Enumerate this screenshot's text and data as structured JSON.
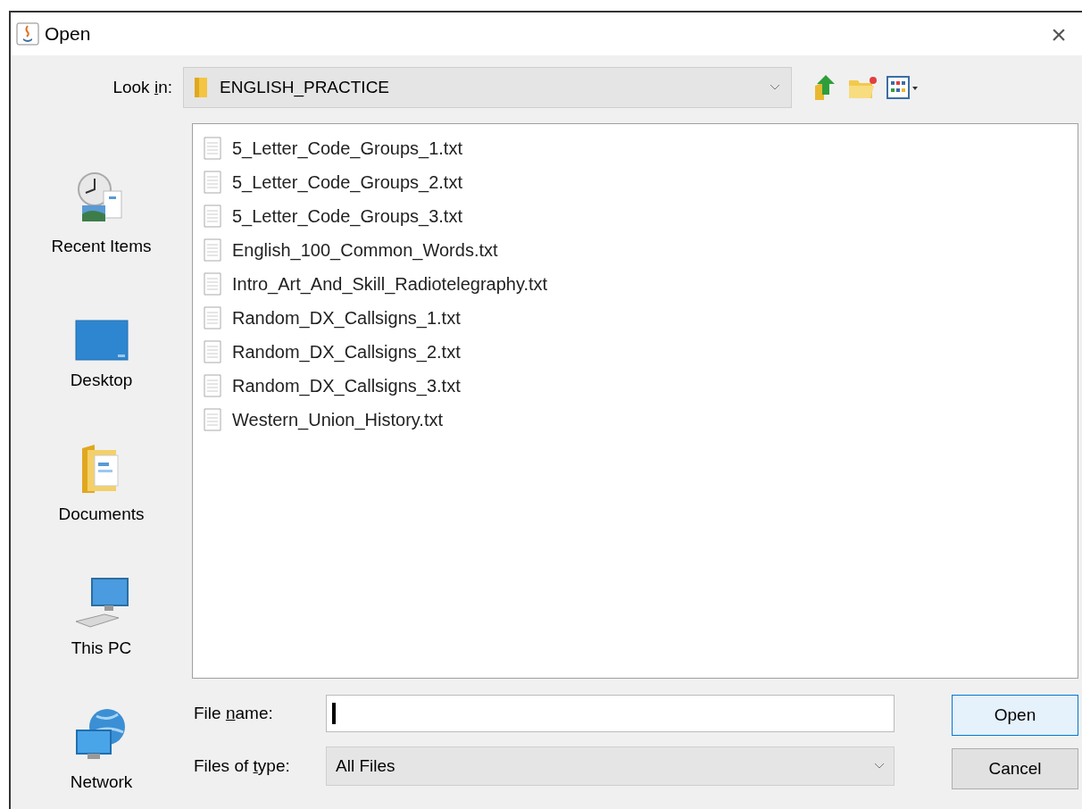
{
  "window": {
    "title": "Open",
    "close": "×"
  },
  "look_in": {
    "label": {
      "before": "Look ",
      "mnemonic": "i",
      "after": "n:"
    },
    "value": "ENGLISH_PRACTICE"
  },
  "sidebar": {
    "items": [
      {
        "kind": "recent",
        "label": "Recent Items"
      },
      {
        "kind": "desktop",
        "label": "Desktop"
      },
      {
        "kind": "documents",
        "label": "Documents"
      },
      {
        "kind": "pc",
        "label": "This PC"
      },
      {
        "kind": "network",
        "label": "Network"
      }
    ]
  },
  "files": [
    {
      "name": "5_Letter_Code_Groups_1.txt"
    },
    {
      "name": "5_Letter_Code_Groups_2.txt"
    },
    {
      "name": "5_Letter_Code_Groups_3.txt"
    },
    {
      "name": "English_100_Common_Words.txt"
    },
    {
      "name": "Intro_Art_And_Skill_Radiotelegraphy.txt"
    },
    {
      "name": "Random_DX_Callsigns_1.txt"
    },
    {
      "name": "Random_DX_Callsigns_2.txt"
    },
    {
      "name": "Random_DX_Callsigns_3.txt"
    },
    {
      "name": "Western_Union_History.txt"
    }
  ],
  "file_name": {
    "label": {
      "before": "File ",
      "mnemonic": "n",
      "after": "ame:"
    }
  },
  "file_type": {
    "label": {
      "before": "Files of ",
      "mnemonic": "t",
      "after": "ype:"
    },
    "value": "All Files"
  },
  "buttons": [
    {
      "label": "Open",
      "kind": "default"
    },
    {
      "label": "Cancel",
      "kind": "normal"
    }
  ]
}
